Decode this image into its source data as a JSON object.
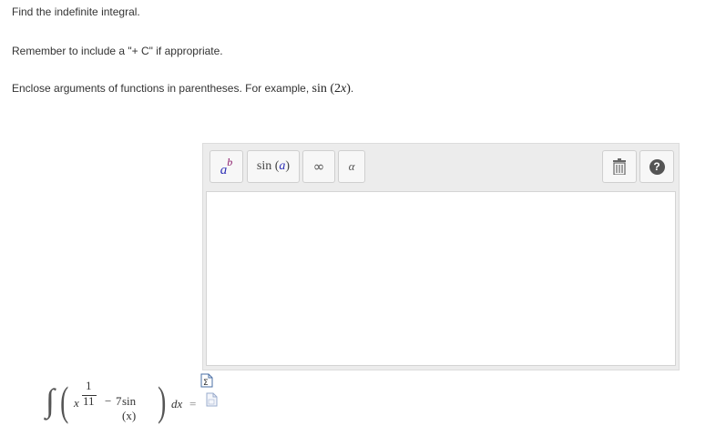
{
  "instructions": {
    "line1": "Find the indefinite integral.",
    "line2": "Remember to include a \"+ C\" if appropriate.",
    "line3_prefix": "Enclose arguments of functions in parentheses. For example, ",
    "line3_example_fn": "sin",
    "line3_example_arg_open": "(2",
    "line3_example_var": "x",
    "line3_example_arg_close": ")",
    "line3_suffix": "."
  },
  "palette": {
    "superscript_base": "a",
    "superscript_exp": "b",
    "sin_fn": "sin",
    "sin_open": "(",
    "sin_arg": "a",
    "sin_close": ")",
    "infinity_symbol": "∞",
    "alpha_symbol": "α",
    "trash_icon": "trash-icon",
    "help_symbol": "?"
  },
  "answer": {
    "value": ""
  },
  "expression": {
    "integral_sign": "∫",
    "left_paren": "(",
    "numerator": "1",
    "var_x": "x",
    "denominator": "11",
    "minus": "−",
    "coefficient": "7",
    "sin_term": "sin (x)",
    "right_paren": ")",
    "differential": "dx",
    "equals": "="
  },
  "colors": {
    "accent_blue": "#2d2fb5",
    "accent_purple": "#8b1a6a",
    "palette_bg": "#ececec"
  }
}
